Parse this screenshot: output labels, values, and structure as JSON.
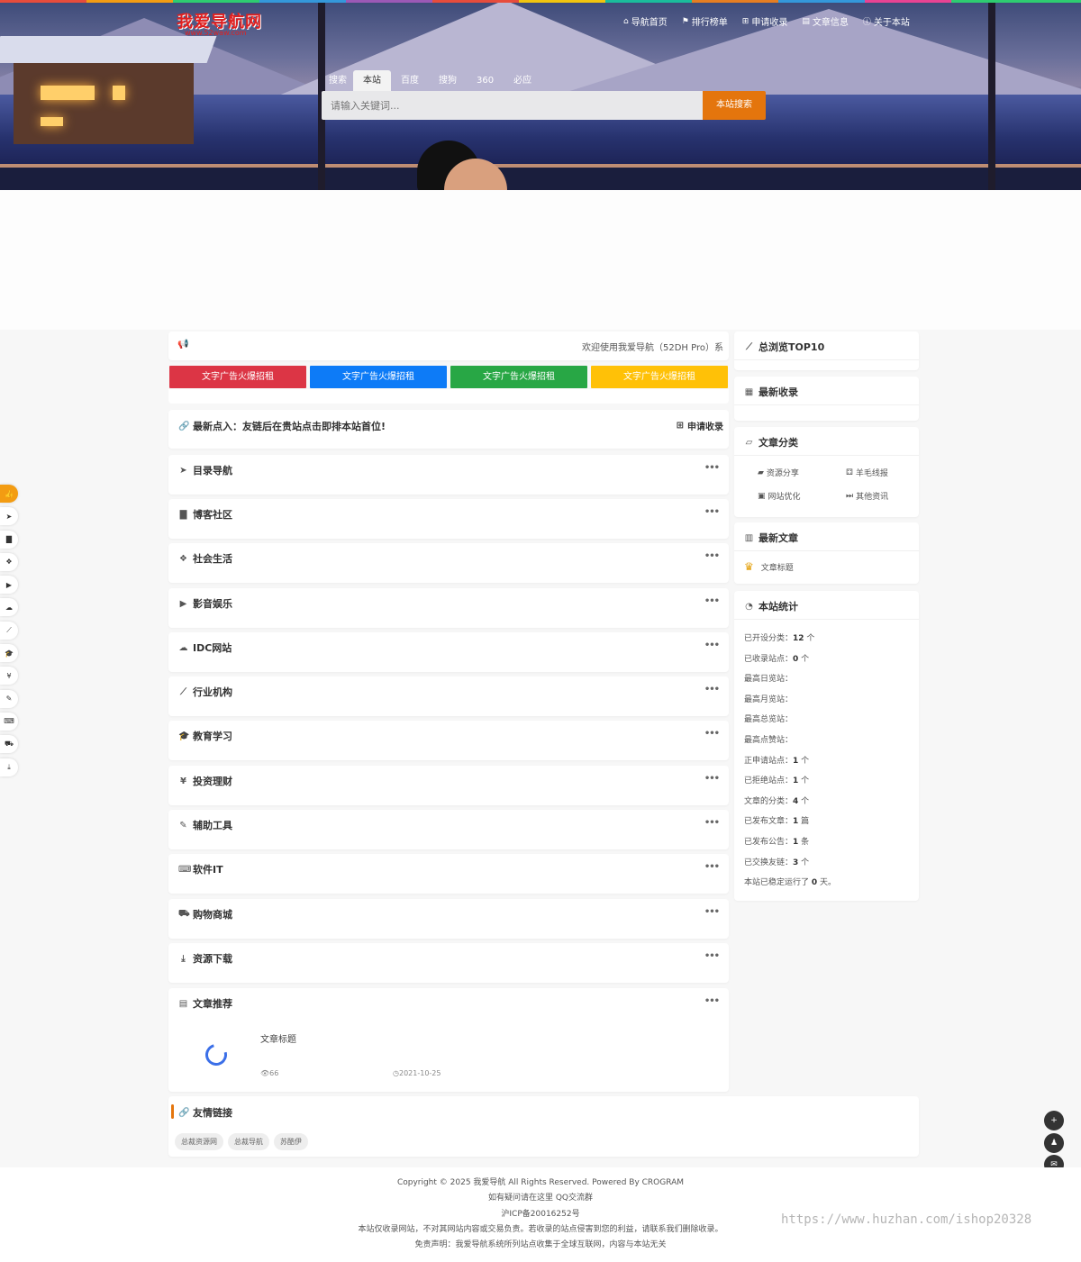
{
  "brand": {
    "logo": "我爱导航网",
    "url": "www.52waw.com"
  },
  "nav": [
    {
      "icon": "home-icon",
      "glyph": "⌂",
      "label": "导航首页"
    },
    {
      "icon": "flag-icon",
      "glyph": "⚑",
      "label": "排行榜单"
    },
    {
      "icon": "plus-square-icon",
      "glyph": "⊞",
      "label": "申请收录"
    },
    {
      "icon": "book-icon",
      "glyph": "▤",
      "label": "文章信息"
    },
    {
      "icon": "info-icon",
      "glyph": "ⓘ",
      "label": "关于本站"
    }
  ],
  "search": {
    "label": "搜索",
    "engines": [
      "本站",
      "百度",
      "搜狗",
      "360",
      "必应"
    ],
    "active": "本站",
    "placeholder": "请输入关键词...",
    "button": "本站搜索"
  },
  "notice": {
    "icon": "megaphone-icon",
    "text": "欢迎使用我爱导航（52DH Pro）系"
  },
  "ads": [
    {
      "label": "文字广告火爆招租",
      "color": "#dc3545"
    },
    {
      "label": "文字广告火爆招租",
      "color": "#0d7bf7"
    },
    {
      "label": "文字广告火爆招租",
      "color": "#28a745"
    },
    {
      "label": "文字广告火爆招租",
      "color": "#ffc107"
    }
  ],
  "latest": {
    "title": "最新点入：友链后在贵站点击即排本站首位!",
    "apply": "申请收录"
  },
  "categories": [
    {
      "name": "目录导航",
      "icon": "paper-plane-icon",
      "glyph": "➤"
    },
    {
      "name": "博客社区",
      "icon": "file-icon",
      "glyph": "▇"
    },
    {
      "name": "社会生活",
      "icon": "cubes-icon",
      "glyph": "❖"
    },
    {
      "name": "影音娱乐",
      "icon": "youtube-icon",
      "glyph": "▶"
    },
    {
      "name": "IDC网站",
      "icon": "cloud-icon",
      "glyph": "☁"
    },
    {
      "name": "行业机构",
      "icon": "line-chart-icon",
      "glyph": "⟋"
    },
    {
      "name": "教育学习",
      "icon": "graduation-cap-icon",
      "glyph": "🎓"
    },
    {
      "name": "投资理财",
      "icon": "yen-icon",
      "glyph": "¥"
    },
    {
      "name": "辅助工具",
      "icon": "wrench-icon",
      "glyph": "✎"
    },
    {
      "name": "软件IT",
      "icon": "keyboard-icon",
      "glyph": "⌨"
    },
    {
      "name": "购物商城",
      "icon": "cart-icon",
      "glyph": "⛟"
    },
    {
      "name": "资源下载",
      "icon": "download-icon",
      "glyph": "⤓"
    }
  ],
  "more": "•••",
  "article_section": {
    "title": "文章推荐",
    "icon": "book-icon",
    "item": {
      "title": "文章标题",
      "views": "66",
      "date": "2021-10-25"
    }
  },
  "friends": {
    "title": "友情链接",
    "items": [
      "总裁资源网",
      "总裁导航",
      "苏酷伊"
    ]
  },
  "sidebar": {
    "top10": {
      "title": "总浏览TOP10",
      "icon": "line-chart-icon"
    },
    "newsite": {
      "title": "最新收录",
      "icon": "newspaper-icon"
    },
    "artcats": {
      "title": "文章分类",
      "icon": "folder-open-icon",
      "items": [
        {
          "label": "资源分享",
          "glyph": "▰"
        },
        {
          "label": "羊毛线报",
          "glyph": "⚃"
        },
        {
          "label": "网站优化",
          "glyph": "▣"
        },
        {
          "label": "其他资讯",
          "glyph": "⏭"
        }
      ]
    },
    "newart": {
      "title": "最新文章",
      "icon": "bar-chart-icon",
      "item": "文章标题"
    },
    "stats": {
      "title": "本站统计",
      "icon": "pie-chart-icon",
      "rows": [
        {
          "label": "已开设分类：",
          "value": "12",
          "unit": " 个"
        },
        {
          "label": "已收录站点：",
          "value": "0",
          "unit": " 个"
        },
        {
          "label": "最高日览站：",
          "value": "",
          "unit": ""
        },
        {
          "label": "最高月览站：",
          "value": "",
          "unit": ""
        },
        {
          "label": "最高总览站：",
          "value": "",
          "unit": ""
        },
        {
          "label": "最高点赞站：",
          "value": "",
          "unit": ""
        },
        {
          "label": "正申请站点：",
          "value": "1",
          "unit": " 个"
        },
        {
          "label": "已拒绝站点：",
          "value": "1",
          "unit": " 个"
        },
        {
          "label": "文章的分类：",
          "value": "4",
          "unit": " 个"
        },
        {
          "label": "已发布文章：",
          "value": "1",
          "unit": " 篇"
        },
        {
          "label": "已发布公告：",
          "value": "1",
          "unit": " 条"
        },
        {
          "label": "已交换友链：",
          "value": "3",
          "unit": " 个"
        },
        {
          "label": "本站已稳定运行了 ",
          "value": "0",
          "unit": " 天。"
        }
      ]
    }
  },
  "leftbar": [
    "thumbs-up-icon",
    "paper-plane-icon",
    "file-icon",
    "cubes-icon",
    "youtube-icon",
    "cloud-icon",
    "line-chart-icon",
    "graduation-cap-icon",
    "yen-icon",
    "wrench-icon",
    "keyboard-icon",
    "cart-icon",
    "download-icon"
  ],
  "rightbtns": [
    "plus-square-icon",
    "qq-icon",
    "wechat-icon",
    "envelope-icon"
  ],
  "footer": [
    "Copyright © 2025 我爱导航 All Rights Reserved. Powered By CROGRAM",
    "如有疑问请在这里 QQ交流群",
    "沪ICP备20016252号",
    "本站仅收录网站，不对其网站内容或交易负责。若收录的站点侵害到您的利益，请联系我们删除收录。",
    "免责声明：我爱导航系统所列站点收集于全球互联网，内容与本站无关"
  ],
  "watermark": "https://www.huzhan.com/ishop20328"
}
